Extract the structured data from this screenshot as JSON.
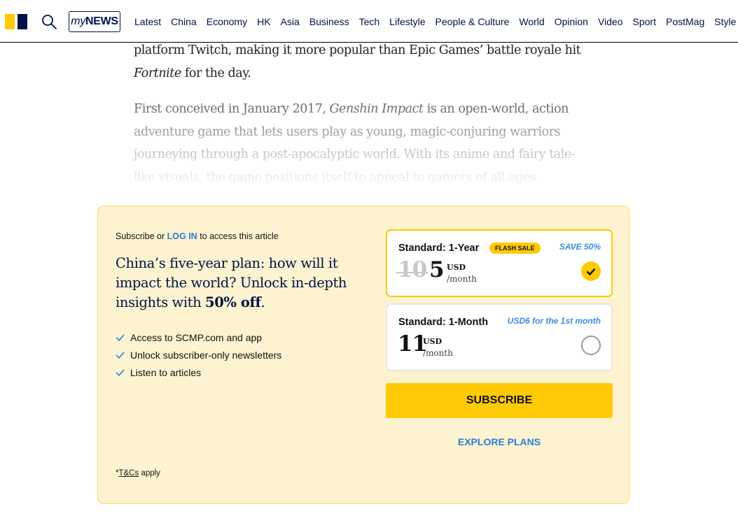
{
  "nav": {
    "mynews_prefix": "my",
    "mynews_suffix": "NEWS",
    "links": [
      "Latest",
      "China",
      "Economy",
      "HK",
      "Asia",
      "Business",
      "Tech",
      "Lifestyle",
      "People & Culture",
      "World",
      "Opinion",
      "Video",
      "Sport",
      "PostMag",
      "Style"
    ]
  },
  "article": {
    "p1_text": "platform Twitch, making it more popular than Epic Games’ battle royale hit ",
    "p1_italic": "Fortnite",
    "p1_end": " for the day.",
    "p2_pre": "First conceived in January 2017, ",
    "p2_italic": "Genshin Impact",
    "p2_text": " is an open-world, action adventure game that lets users play as young, magic-conjuring warriors journeying through a post-apocalyptic world. With its anime and fairy tale-like visuals, the game positions itself to appeal to gamers of all ages."
  },
  "paywall": {
    "kicker_pre": "Subscribe or ",
    "kicker_login": "LOG IN",
    "kicker_post": " to access this article",
    "headline_pre": "China’s five-year plan: how will it impact the world? Unlock in-depth insights with ",
    "headline_bold": "50% off",
    "headline_end": ".",
    "benefits": [
      "Access to SCMP.com and app",
      "Unlock subscriber-only newsletters",
      "Listen to articles"
    ],
    "tcs_prefix": "*",
    "tcs_link": "T&Cs",
    "tcs_suffix": " apply",
    "plans": [
      {
        "name": "Standard: 1-Year",
        "badge": "FLASH SALE",
        "promo": "SAVE 50%",
        "old_price": "10",
        "price": "5",
        "currency": "USD",
        "period": "/month",
        "selected": true
      },
      {
        "name": "Standard: 1-Month",
        "promo": "USD6 for the 1st month",
        "price": "11",
        "currency": "USD",
        "period": "/month",
        "selected": false
      }
    ],
    "subscribe_label": "SUBSCRIBE",
    "explore_label": "EXPLORE PLANS"
  },
  "colors": {
    "brand_yellow": "#ffca05",
    "brand_navy": "#001246",
    "link_blue": "#2d7cd8",
    "paywall_bg": "#fef3d0"
  },
  "icons": [
    "logo",
    "search-icon",
    "check-icon",
    "checkmark-icon"
  ]
}
